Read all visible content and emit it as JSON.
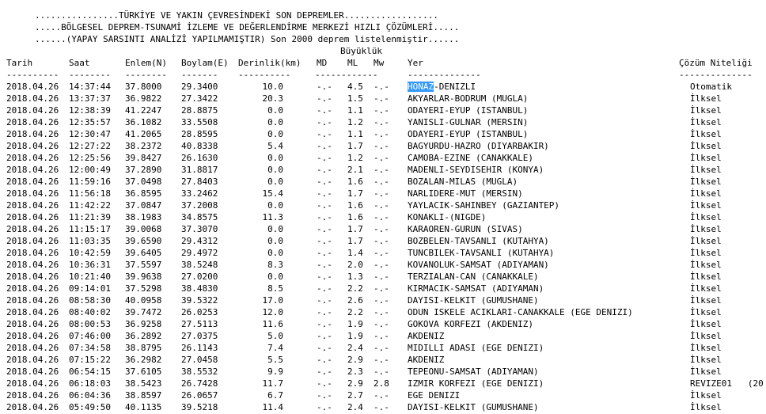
{
  "header": {
    "line1": "................TÜRKİYE VE YAKIN ÇEVRESİNDEKİ SON DEPREMLER..................",
    "line2": ".....BÖLGESEL DEPREM-TSUNAMİ İZLEME VE DEĞERLENDİRME MERKEZİ HIZLI ÇÖZÜMLERİ.....",
    "line3": "......(YAPAY SARSINTI ANALİZİ YAPILMAMIŞTIR) Son 2000 deprem listelenmiştir......"
  },
  "columns": {
    "buyukluk": "Büyüklük",
    "tarih": "Tarih",
    "saat": "Saat",
    "enlem": "Enlem(N)",
    "boylam": "Boylam(E)",
    "derinlik": "Derinlik(km)",
    "md": "MD",
    "ml": "ML",
    "mw": "Mw",
    "yer": "Yer",
    "cozum": "Çözüm Niteliği",
    "sep_tarih": "----------",
    "sep_saat": "--------",
    "sep_enlem": "--------",
    "sep_boylam": "-------",
    "sep_derinlik": "----------",
    "sep_mag": "------------",
    "sep_yer": "--------------",
    "sep_cozum": "--------------"
  },
  "rows": [
    {
      "tarih": "2018.04.26",
      "saat": "14:37:44",
      "enlem": "37.8000",
      "boylam": "29.3400",
      "derinlik": "10.0",
      "md": "-.-",
      "ml": "4.5",
      "mw": "-.-",
      "yer_hl": "HONAZ",
      "yer": "-DENIZLI",
      "cozum": "Otomatik"
    },
    {
      "tarih": "2018.04.26",
      "saat": "13:37:37",
      "enlem": "36.9822",
      "boylam": "27.3422",
      "derinlik": "20.3",
      "md": "-.-",
      "ml": "1.5",
      "mw": "-.-",
      "yer_hl": "",
      "yer": "AKYARLAR-BODRUM (MUGLA)",
      "cozum": "İlksel"
    },
    {
      "tarih": "2018.04.26",
      "saat": "12:38:39",
      "enlem": "41.2247",
      "boylam": "28.8875",
      "derinlik": "0.0",
      "md": "-.-",
      "ml": "1.1",
      "mw": "-.-",
      "yer_hl": "",
      "yer": "ODAYERI-EYUP (ISTANBUL)",
      "cozum": "İlksel"
    },
    {
      "tarih": "2018.04.26",
      "saat": "12:35:57",
      "enlem": "36.1082",
      "boylam": "33.5508",
      "derinlik": "0.0",
      "md": "-.-",
      "ml": "1.2",
      "mw": "-.-",
      "yer_hl": "",
      "yer": "YANISLI-GULNAR (MERSIN)",
      "cozum": "İlksel"
    },
    {
      "tarih": "2018.04.26",
      "saat": "12:30:47",
      "enlem": "41.2065",
      "boylam": "28.8595",
      "derinlik": "0.0",
      "md": "-.-",
      "ml": "1.1",
      "mw": "-.-",
      "yer_hl": "",
      "yer": "ODAYERI-EYUP (ISTANBUL)",
      "cozum": "İlksel"
    },
    {
      "tarih": "2018.04.26",
      "saat": "12:27:22",
      "enlem": "38.2372",
      "boylam": "40.8338",
      "derinlik": "5.4",
      "md": "-.-",
      "ml": "1.7",
      "mw": "-.-",
      "yer_hl": "",
      "yer": "BAGYURDU-HAZRO (DIYARBAKIR)",
      "cozum": "İlksel"
    },
    {
      "tarih": "2018.04.26",
      "saat": "12:25:56",
      "enlem": "39.8427",
      "boylam": "26.1630",
      "derinlik": "0.0",
      "md": "-.-",
      "ml": "1.2",
      "mw": "-.-",
      "yer_hl": "",
      "yer": "CAMOBA-EZINE (CANAKKALE)",
      "cozum": "İlksel"
    },
    {
      "tarih": "2018.04.26",
      "saat": "12:00:49",
      "enlem": "37.2890",
      "boylam": "31.8817",
      "derinlik": "0.0",
      "md": "-.-",
      "ml": "2.1",
      "mw": "-.-",
      "yer_hl": "",
      "yer": "MADENLI-SEYDISEHIR (KONYA)",
      "cozum": "İlksel"
    },
    {
      "tarih": "2018.04.26",
      "saat": "11:59:16",
      "enlem": "37.0498",
      "boylam": "27.8403",
      "derinlik": "0.0",
      "md": "-.-",
      "ml": "1.6",
      "mw": "-.-",
      "yer_hl": "",
      "yer": "BOZALAN-MILAS (MUGLA)",
      "cozum": "İlksel"
    },
    {
      "tarih": "2018.04.26",
      "saat": "11:56:18",
      "enlem": "36.8595",
      "boylam": "33.2462",
      "derinlik": "15.4",
      "md": "-.-",
      "ml": "1.7",
      "mw": "-.-",
      "yer_hl": "",
      "yer": "NARLIDERE-MUT (MERSIN)",
      "cozum": "İlksel"
    },
    {
      "tarih": "2018.04.26",
      "saat": "11:42:22",
      "enlem": "37.0847",
      "boylam": "37.2008",
      "derinlik": "0.0",
      "md": "-.-",
      "ml": "1.6",
      "mw": "-.-",
      "yer_hl": "",
      "yer": "YAYLACIK-SAHINBEY (GAZIANTEP)",
      "cozum": "İlksel"
    },
    {
      "tarih": "2018.04.26",
      "saat": "11:21:39",
      "enlem": "38.1983",
      "boylam": "34.8575",
      "derinlik": "11.3",
      "md": "-.-",
      "ml": "1.6",
      "mw": "-.-",
      "yer_hl": "",
      "yer": "KONAKLI-(NIGDE)",
      "cozum": "İlksel"
    },
    {
      "tarih": "2018.04.26",
      "saat": "11:15:17",
      "enlem": "39.0068",
      "boylam": "37.3070",
      "derinlik": "0.0",
      "md": "-.-",
      "ml": "1.7",
      "mw": "-.-",
      "yer_hl": "",
      "yer": "KARAOREN-GURUN (SIVAS)",
      "cozum": "İlksel"
    },
    {
      "tarih": "2018.04.26",
      "saat": "11:03:35",
      "enlem": "39.6590",
      "boylam": "29.4312",
      "derinlik": "0.0",
      "md": "-.-",
      "ml": "1.7",
      "mw": "-.-",
      "yer_hl": "",
      "yer": "BOZBELEN-TAVSANLI (KUTAHYA)",
      "cozum": "İlksel"
    },
    {
      "tarih": "2018.04.26",
      "saat": "10:42:59",
      "enlem": "39.6405",
      "boylam": "29.4972",
      "derinlik": "0.0",
      "md": "-.-",
      "ml": "1.4",
      "mw": "-.-",
      "yer_hl": "",
      "yer": "TUNCBILEK-TAVSANLI (KUTAHYA)",
      "cozum": "İlksel"
    },
    {
      "tarih": "2018.04.26",
      "saat": "10:36:31",
      "enlem": "37.5597",
      "boylam": "38.5248",
      "derinlik": "8.3",
      "md": "-.-",
      "ml": "2.0",
      "mw": "-.-",
      "yer_hl": "",
      "yer": "KOVANOLUK-SAMSAT (ADIYAMAN)",
      "cozum": "İlksel"
    },
    {
      "tarih": "2018.04.26",
      "saat": "10:21:40",
      "enlem": "39.9638",
      "boylam": "27.0200",
      "derinlik": "0.0",
      "md": "-.-",
      "ml": "1.3",
      "mw": "-.-",
      "yer_hl": "",
      "yer": "TERZIALAN-CAN (CANAKKALE)",
      "cozum": "İlksel"
    },
    {
      "tarih": "2018.04.26",
      "saat": "09:14:01",
      "enlem": "37.5298",
      "boylam": "38.4830",
      "derinlik": "8.5",
      "md": "-.-",
      "ml": "2.2",
      "mw": "-.-",
      "yer_hl": "",
      "yer": "KIRMACIK-SAMSAT (ADIYAMAN)",
      "cozum": "İlksel"
    },
    {
      "tarih": "2018.04.26",
      "saat": "08:58:30",
      "enlem": "40.0958",
      "boylam": "39.5322",
      "derinlik": "17.0",
      "md": "-.-",
      "ml": "2.6",
      "mw": "-.-",
      "yer_hl": "",
      "yer": "DAYISI-KELKIT (GUMUSHANE)",
      "cozum": "İlksel"
    },
    {
      "tarih": "2018.04.26",
      "saat": "08:40:02",
      "enlem": "39.7472",
      "boylam": "26.0253",
      "derinlik": "12.0",
      "md": "-.-",
      "ml": "2.2",
      "mw": "-.-",
      "yer_hl": "",
      "yer": "ODUN ISKELE ACIKLARI-CANAKKALE (EGE DENIZI)",
      "cozum": "İlksel"
    },
    {
      "tarih": "2018.04.26",
      "saat": "08:00:53",
      "enlem": "36.9258",
      "boylam": "27.5113",
      "derinlik": "11.6",
      "md": "-.-",
      "ml": "1.9",
      "mw": "-.-",
      "yer_hl": "",
      "yer": "GOKOVA KORFEZI (AKDENIZ)",
      "cozum": "İlksel"
    },
    {
      "tarih": "2018.04.26",
      "saat": "07:46:00",
      "enlem": "36.2892",
      "boylam": "27.0375",
      "derinlik": "5.0",
      "md": "-.-",
      "ml": "1.9",
      "mw": "-.-",
      "yer_hl": "",
      "yer": "AKDENIZ",
      "cozum": "İlksel"
    },
    {
      "tarih": "2018.04.26",
      "saat": "07:34:58",
      "enlem": "38.8795",
      "boylam": "26.1143",
      "derinlik": "7.4",
      "md": "-.-",
      "ml": "2.4",
      "mw": "-.-",
      "yer_hl": "",
      "yer": "MIDILLI ADASI (EGE DENIZI)",
      "cozum": "İlksel"
    },
    {
      "tarih": "2018.04.26",
      "saat": "07:15:22",
      "enlem": "36.2982",
      "boylam": "27.0458",
      "derinlik": "5.5",
      "md": "-.-",
      "ml": "2.9",
      "mw": "-.-",
      "yer_hl": "",
      "yer": "AKDENIZ",
      "cozum": "İlksel"
    },
    {
      "tarih": "2018.04.26",
      "saat": "06:54:15",
      "enlem": "37.6105",
      "boylam": "38.5532",
      "derinlik": "9.9",
      "md": "-.-",
      "ml": "2.3",
      "mw": "-.-",
      "yer_hl": "",
      "yer": "TEPEONU-SAMSAT (ADIYAMAN)",
      "cozum": "İlksel"
    },
    {
      "tarih": "2018.04.26",
      "saat": "06:18:03",
      "enlem": "38.5423",
      "boylam": "26.7428",
      "derinlik": "11.7",
      "md": "-.-",
      "ml": "2.9",
      "mw": "2.8",
      "yer_hl": "",
      "yer": "IZMIR KORFEZI (EGE DENIZI)",
      "cozum": "REVIZE01   (20"
    },
    {
      "tarih": "2018.04.26",
      "saat": "06:04:36",
      "enlem": "38.8597",
      "boylam": "26.0657",
      "derinlik": "6.7",
      "md": "-.-",
      "ml": "2.7",
      "mw": "-.-",
      "yer_hl": "",
      "yer": "EGE DENIZI",
      "cozum": "İlksel"
    },
    {
      "tarih": "2018.04.26",
      "saat": "05:49:50",
      "enlem": "40.1135",
      "boylam": "39.5218",
      "derinlik": "11.4",
      "md": "-.-",
      "ml": "2.4",
      "mw": "-.-",
      "yer_hl": "",
      "yer": "DAYISI-KELKIT (GUMUSHANE)",
      "cozum": "İlksel"
    }
  ]
}
